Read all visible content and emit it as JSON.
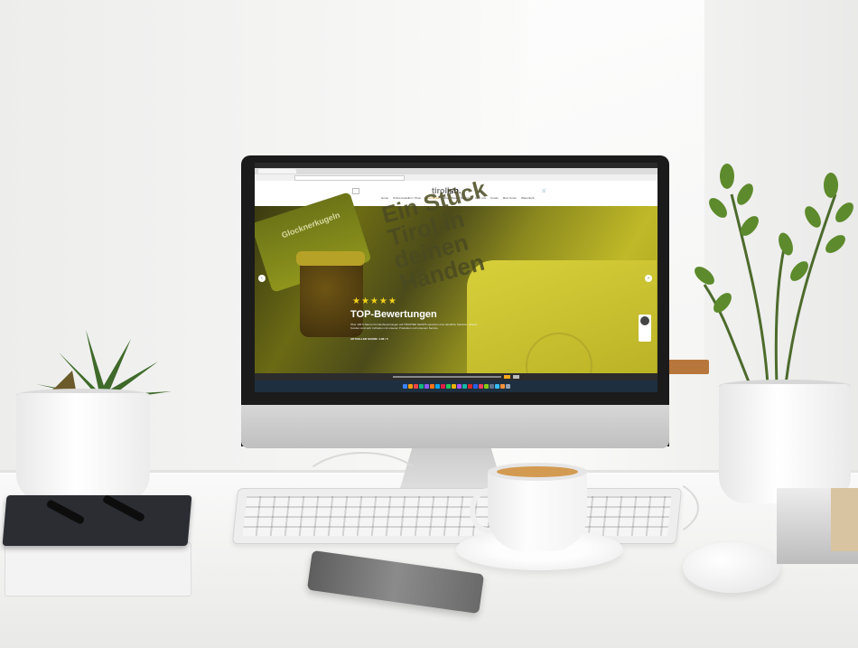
{
  "screen_site": {
    "logo_word": "tirol",
    "logo_bold": "ish.",
    "nav_items": [
      "Home",
      "Online bestellen / Shop",
      "Geschenke",
      "Blog / News / Rezepte",
      "Über uns",
      "Kunde",
      "Mein Konto",
      "Warenkorb"
    ],
    "hero_book_text": "Ein Stück Tirol in deinen Händen",
    "jar_label": "Glocknerkugeln",
    "hero_stars": "★★★★★",
    "hero_title": "TOP-Bewertungen",
    "hero_body": "Über 100 5-Sterne Kundenbewertungen auf TRUSTED SHOPS sprechen eine deutliche Sprache. Unsere Kunden sind sehr zufrieden mit unseren Produkten und unserem Service.",
    "hero_cta": "AKTUELLER SCORE: 4.96 / 5"
  },
  "colors": {
    "hero_accent": "#f2d11c",
    "cookie_button": "#f3a91a",
    "dock_bg": "#1e3040"
  }
}
